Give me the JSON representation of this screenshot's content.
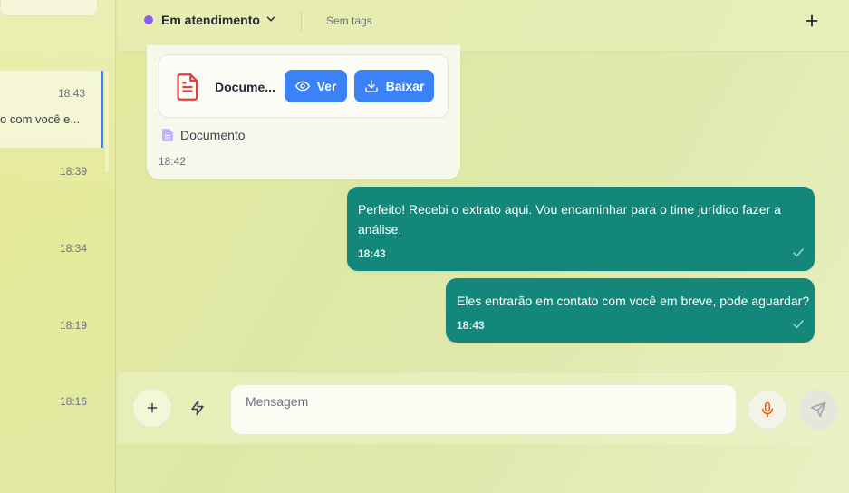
{
  "sidebar": {
    "conversations": [
      {
        "time": "18:43",
        "preview": "o com você e..."
      },
      {
        "time": "18:39"
      },
      {
        "time": "18:34"
      },
      {
        "time": "18:19"
      },
      {
        "time": "18:16"
      }
    ]
  },
  "header": {
    "status": "Em atendimento",
    "status_color": "#8b5cf6",
    "tags": "Sem tags",
    "add_icon": "plus-icon"
  },
  "messages": [
    {
      "direction": "incoming",
      "attachment": {
        "name": "Docume...",
        "icon": "document-icon",
        "view_label": "Ver",
        "download_label": "Baixar"
      },
      "caption": "Documento",
      "time": "18:42"
    },
    {
      "direction": "outgoing",
      "text": "Perfeito! Recebi o extrato aqui. Vou encaminhar para o time jurídico fazer a análise.",
      "time": "18:43"
    },
    {
      "direction": "outgoing",
      "text": "Eles entrarão em contato com você em breve, pode aguardar?",
      "time": "18:43"
    }
  ],
  "composer": {
    "placeholder": "Mensagem",
    "attach_icon": "plus-icon",
    "quick_reply_icon": "lightning-icon",
    "mic_icon": "microphone-icon",
    "send_icon": "send-icon"
  },
  "colors": {
    "accent": "#3b82f6",
    "outgoing_bubble": "#12877a",
    "mic": "#ea580c"
  }
}
